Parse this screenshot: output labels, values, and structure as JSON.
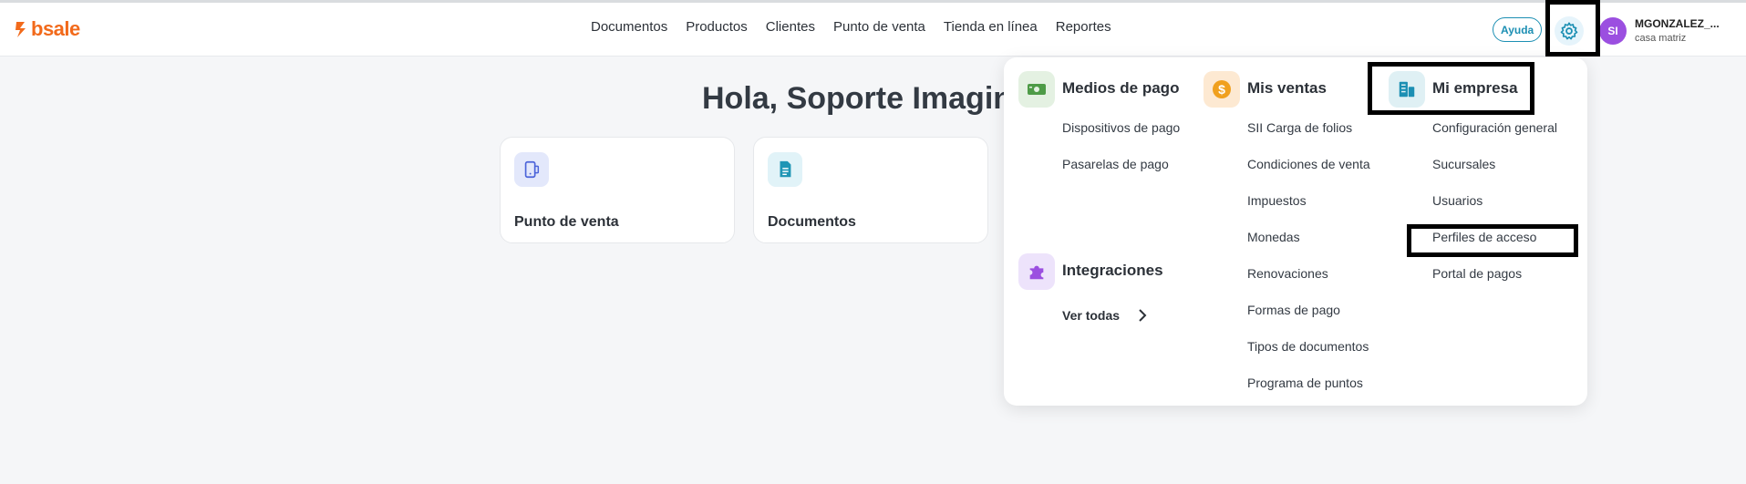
{
  "header": {
    "logo_text": "bsale",
    "nav": [
      "Documentos",
      "Productos",
      "Clientes",
      "Punto de venta",
      "Tienda en línea",
      "Reportes"
    ],
    "help_label": "Ayuda",
    "settings_icon": "gear-icon",
    "user": {
      "initials": "SI",
      "name": "MGONZALEZ_...",
      "branch": "casa matriz"
    }
  },
  "main": {
    "greeting": "Hola, Soporte Imagin",
    "cards": [
      {
        "title": "Punto de venta",
        "icon": "pos-device-icon",
        "icon_bg": "#e3e8fb",
        "icon_color": "#4b63d9"
      },
      {
        "title": "Documentos",
        "icon": "document-icon",
        "icon_bg": "#e1f3f8",
        "icon_color": "#1f95b5"
      }
    ]
  },
  "settings_menu": {
    "medios_de_pago": {
      "title": "Medios de pago",
      "icon": "money-icon",
      "items": [
        "Dispositivos de pago",
        "Pasarelas de pago"
      ]
    },
    "mis_ventas": {
      "title": "Mis ventas",
      "icon": "dollar-coin-icon",
      "items": [
        "SII Carga de folios",
        "Condiciones de venta",
        "Impuestos",
        "Monedas",
        "Renovaciones",
        "Formas de pago",
        "Tipos de documentos",
        "Programa de puntos"
      ]
    },
    "mi_empresa": {
      "title": "Mi empresa",
      "icon": "building-icon",
      "items": [
        "Configuración general",
        "Sucursales",
        "Usuarios",
        "Perfiles de acceso",
        "Portal de pagos"
      ]
    },
    "integraciones": {
      "title": "Integraciones",
      "icon": "puzzle-icon",
      "see_all": "Ver todas"
    }
  },
  "colors": {
    "brand": "#f26a1b",
    "accent": "#1c8fb3",
    "avatar": "#9b4fe0",
    "highlight_box": "#000000"
  }
}
